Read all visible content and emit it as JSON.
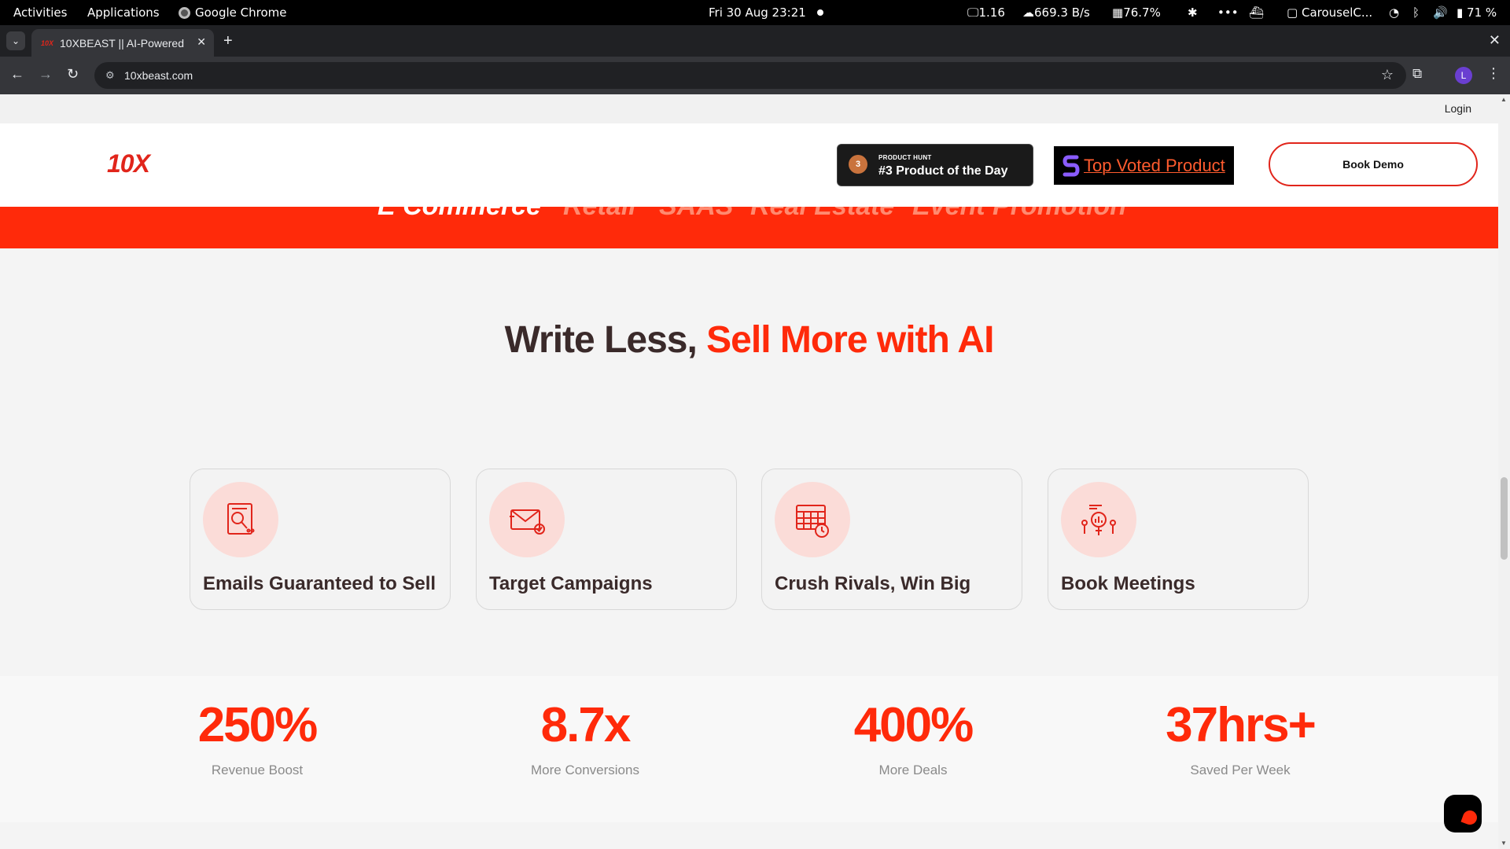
{
  "system_bar": {
    "activities": "Activities",
    "applications": "Applications",
    "app_name": "Google Chrome",
    "datetime": "Fri 30 Aug  23:21",
    "load": "1.16",
    "network": "669.3 B/s",
    "memory": "76.7%",
    "overflow": "•••",
    "window_label": "CarouselC...",
    "battery": "71 %"
  },
  "browser": {
    "tab_title": "10XBEAST || AI-Powered",
    "url": "10xbeast.com",
    "profile_initial": "L"
  },
  "site": {
    "login": "Login",
    "logo_text": "10X",
    "product_hunt": {
      "small": "PRODUCT HUNT",
      "main": "#3 Product of the Day",
      "rank": "3"
    },
    "top_voted": "Top Voted Product",
    "book_demo": "Book Demo",
    "ribbon_words": [
      "E Commerce",
      "Retail",
      "SAAS",
      "Real Estate",
      "Event Promotion"
    ],
    "headline": {
      "dark": "Write Less, ",
      "accent": "Sell More with AI"
    },
    "features": [
      {
        "title": "Emails Guaranteed to Sell",
        "icon": "email-analysis-icon"
      },
      {
        "title": "Target Campaigns",
        "icon": "envelope-check-icon"
      },
      {
        "title": "Crush Rivals, Win Big",
        "icon": "calendar-clock-icon"
      },
      {
        "title": "Book Meetings",
        "icon": "meeting-presentation-icon"
      }
    ],
    "stats": [
      {
        "value": "250%",
        "label": "Revenue Boost"
      },
      {
        "value": "8.7x",
        "label": "More Conversions"
      },
      {
        "value": "400%",
        "label": "More Deals"
      },
      {
        "value": "37hrs+",
        "label": "Saved Per Week"
      }
    ]
  },
  "colors": {
    "accent": "#ff2a0a",
    "dark_text": "#3a2a2a",
    "icon_bg": "#fbdcd8"
  }
}
